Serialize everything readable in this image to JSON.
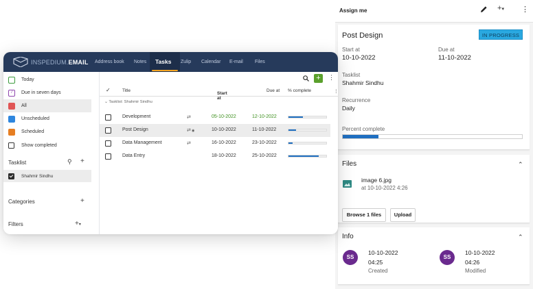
{
  "app": {
    "logo_prefix": "INSPEDIUM.",
    "logo_suffix": "EMAIL",
    "nav": [
      "Address book",
      "Notes",
      "Tasks",
      "Zulip",
      "Calendar",
      "E-mail",
      "Files"
    ],
    "active_nav": "Tasks"
  },
  "sidebar": {
    "filters": [
      {
        "label": "Today",
        "color": "#3b9a3b"
      },
      {
        "label": "Due in seven days",
        "color": "#8e44ad"
      },
      {
        "label": "All",
        "color": "#e05555"
      },
      {
        "label": "Unscheduled",
        "color": "#2e86de"
      },
      {
        "label": "Scheduled",
        "color": "#e67e22"
      }
    ],
    "show_completed": "Show completed",
    "tasklist_title": "Tasklist",
    "tasklist_item": "Shahmir Sindhu",
    "categories_title": "Categories",
    "filters_title": "Filters"
  },
  "table": {
    "headers": {
      "title": "Title",
      "start": "Start at",
      "due": "Due at",
      "complete": "% complete"
    },
    "group": "Tasklist: Shahmir Sindhu",
    "rows": [
      {
        "title": "Development",
        "start": "05-10-2022",
        "due": "12-10-2022",
        "complete": 0.38
      },
      {
        "title": "Post Design",
        "start": "10-10-2022",
        "due": "11-10-2022",
        "complete": 0.2
      },
      {
        "title": "Data Management",
        "start": "16-10-2022",
        "due": "23-10-2022",
        "complete": 0.1
      },
      {
        "title": "Data Entry",
        "start": "18-10-2022",
        "due": "25-10-2022",
        "complete": 0.8
      }
    ]
  },
  "panel": {
    "assign": "Assign me",
    "title": "Post Design",
    "status": "IN PROGRESS",
    "start_label": "Start at",
    "start_value": "10-10-2022",
    "due_label": "Due at",
    "due_value": "11-10-2022",
    "tasklist_label": "Tasklist",
    "tasklist_value": "Shahmir Sindhu",
    "recurrence_label": "Recurrence",
    "recurrence_value": "Daily",
    "percent_label": "Percent complete",
    "percent_value": 0.2,
    "files_title": "Files",
    "file_name": "image 6.jpg",
    "file_meta": "at 10-10-2022 4:26",
    "browse_btn": "Browse 1 files",
    "upload_btn": "Upload",
    "info_title": "Info",
    "created": {
      "initials": "SS",
      "date": "10-10-2022",
      "time": "04:25",
      "label": "Created"
    },
    "modified": {
      "initials": "SS",
      "date": "10-10-2022",
      "time": "04:26",
      "label": "Modified"
    }
  }
}
